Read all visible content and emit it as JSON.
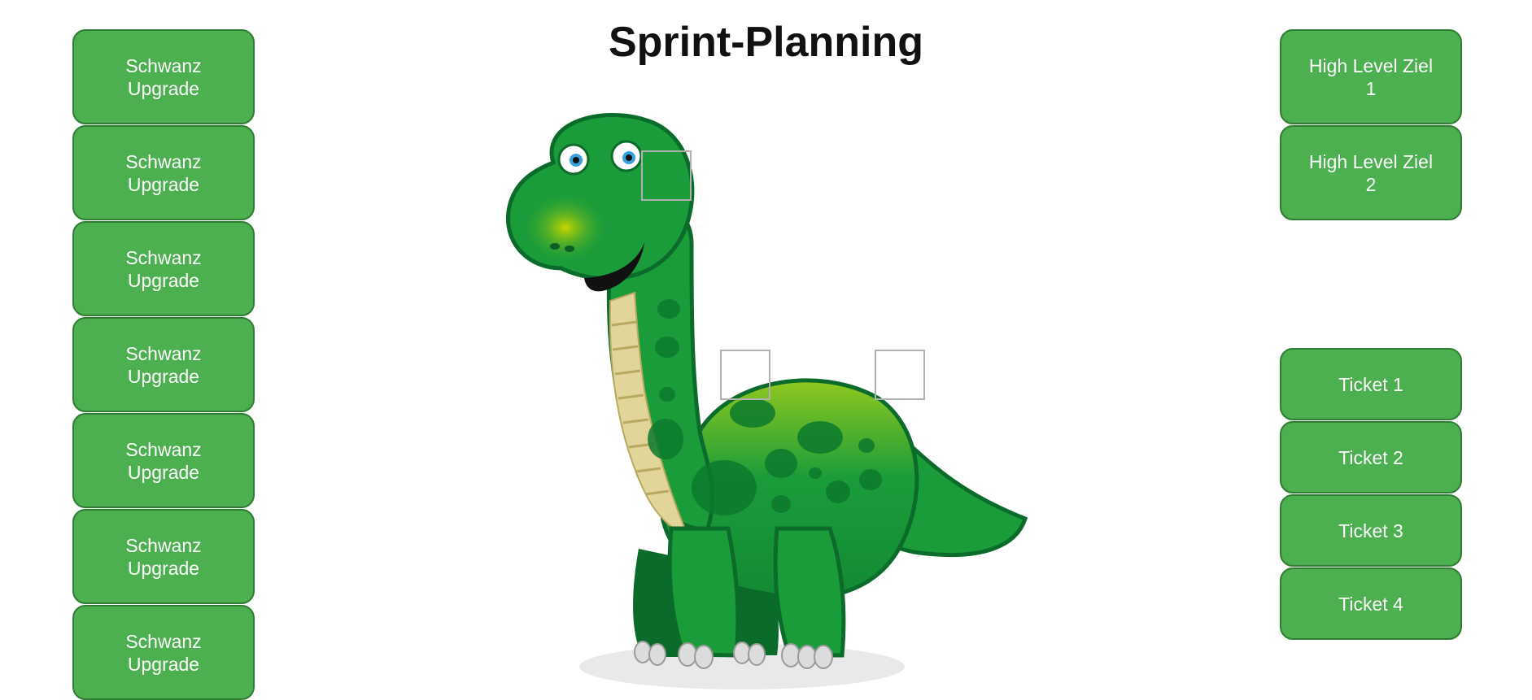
{
  "page": {
    "title": "Sprint-Planning"
  },
  "upgrades": [
    {
      "label": "Schwanz\nUpgrade"
    },
    {
      "label": "Schwanz\nUpgrade"
    },
    {
      "label": "Schwanz\nUpgrade"
    },
    {
      "label": "Schwanz\nUpgrade"
    },
    {
      "label": "Schwanz\nUpgrade"
    },
    {
      "label": "Schwanz\nUpgrade"
    },
    {
      "label": "Schwanz\nUpgrade"
    }
  ],
  "goals": [
    {
      "label": "High Level Ziel\n1"
    },
    {
      "label": "High Level Ziel\n2"
    }
  ],
  "tickets": [
    {
      "label": "Ticket 1"
    },
    {
      "label": "Ticket 2"
    },
    {
      "label": "Ticket 3"
    },
    {
      "label": "Ticket 4"
    }
  ],
  "colors": {
    "button_fill": "#4caf50",
    "button_border": "#2e7d32",
    "dino_body": "#1a9c3a",
    "dino_dark": "#0b6b2a",
    "dino_belly": "#e2d59a"
  },
  "icons": {
    "mascot": "green-dinosaur-illustration"
  }
}
